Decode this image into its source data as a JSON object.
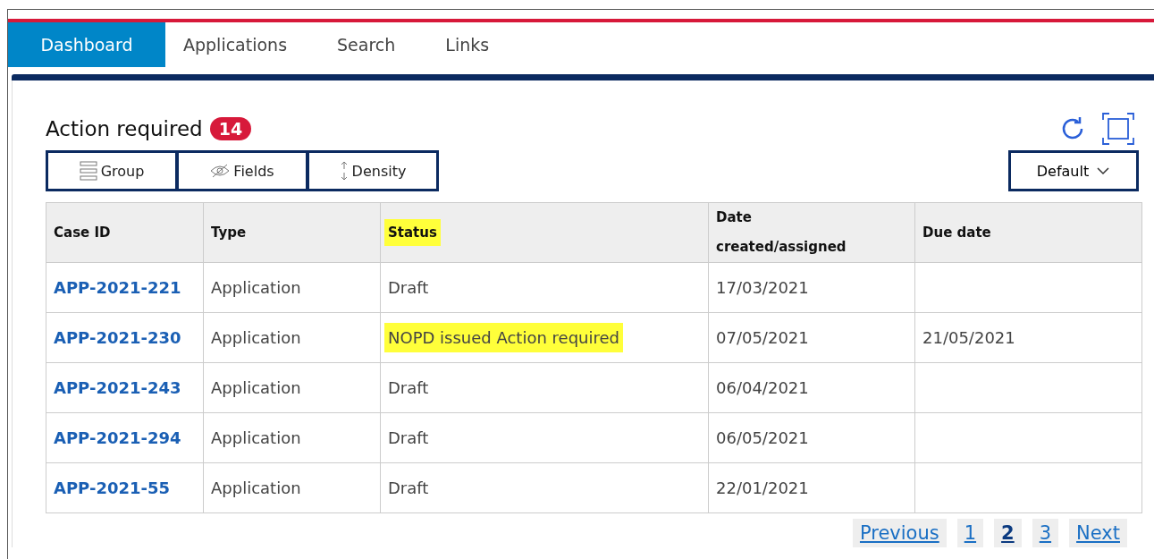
{
  "tabs": [
    {
      "label": "Dashboard",
      "selected": true
    },
    {
      "label": "Applications",
      "selected": false
    },
    {
      "label": "Search",
      "selected": false
    },
    {
      "label": "Links",
      "selected": false
    }
  ],
  "panel": {
    "title": "Action required",
    "count": "14"
  },
  "toolbar": [
    {
      "label": "Group",
      "kind": "group"
    },
    {
      "label": "Fields",
      "kind": "fields"
    },
    {
      "label": "Density",
      "kind": "density"
    }
  ],
  "view_select": {
    "value": "Default"
  },
  "table": {
    "columns": [
      {
        "label": "Case ID",
        "highlighted": false
      },
      {
        "label": "Type",
        "highlighted": false
      },
      {
        "label": "Status",
        "highlighted": true
      },
      {
        "label": "Date created/assigned",
        "highlighted": false
      },
      {
        "label": "Due date",
        "highlighted": false
      }
    ],
    "rows": [
      {
        "case_id": "APP-2021-221",
        "type": "Application",
        "status": "Draft",
        "status_highlighted": false,
        "date": "17/03/2021",
        "due": ""
      },
      {
        "case_id": "APP-2021-230",
        "type": "Application",
        "status": "NOPD issued Action required",
        "status_highlighted": true,
        "date": "07/05/2021",
        "due": "21/05/2021"
      },
      {
        "case_id": "APP-2021-243",
        "type": "Application",
        "status": "Draft",
        "status_highlighted": false,
        "date": "06/04/2021",
        "due": ""
      },
      {
        "case_id": "APP-2021-294",
        "type": "Application",
        "status": "Draft",
        "status_highlighted": false,
        "date": "06/05/2021",
        "due": ""
      },
      {
        "case_id": "APP-2021-55",
        "type": "Application",
        "status": "Draft",
        "status_highlighted": false,
        "date": "22/01/2021",
        "due": ""
      }
    ]
  },
  "pagination": {
    "previous": "Previous",
    "pages": [
      {
        "label": "1",
        "selected": false
      },
      {
        "label": "2",
        "selected": true
      },
      {
        "label": "3",
        "selected": false
      }
    ],
    "next": "Next"
  }
}
